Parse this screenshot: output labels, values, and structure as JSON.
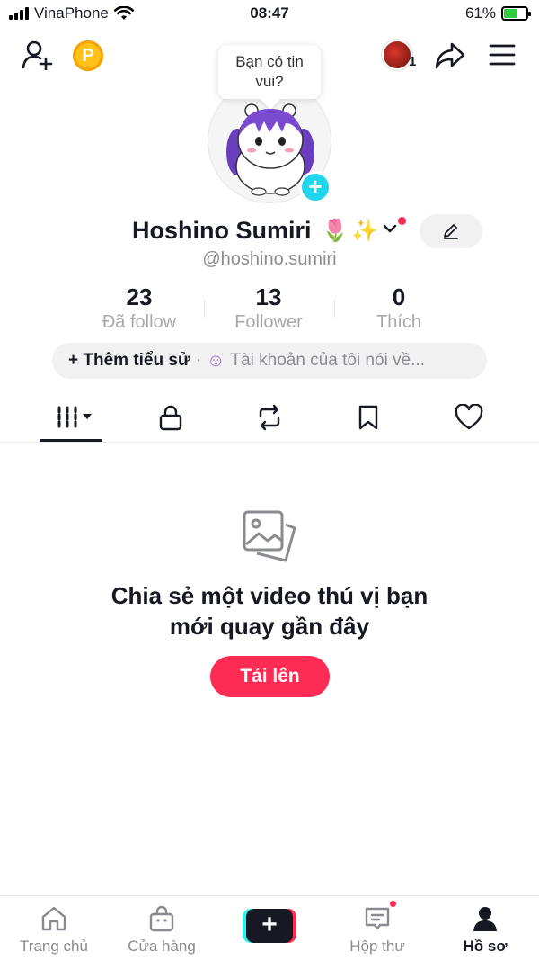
{
  "status_bar": {
    "carrier": "VinaPhone",
    "time": "08:47",
    "battery_percent": "61%",
    "battery_level": 0.61
  },
  "top_bar": {
    "icons": [
      "add-friend-icon",
      "coin-icon",
      "share-icon",
      "menu-icon"
    ],
    "coin_label": "P",
    "story_count": "1"
  },
  "bubble": {
    "text_line1": "Bạn có tin",
    "text_line2": "vui?"
  },
  "profile": {
    "display_name": "Hoshino Sumiri",
    "name_emojis": [
      "🌷",
      "✨"
    ],
    "username": "@hoshino.sumiri"
  },
  "stats": [
    {
      "value": "23",
      "label": "Đã follow"
    },
    {
      "value": "13",
      "label": "Follower"
    },
    {
      "value": "0",
      "label": "Thích"
    }
  ],
  "bio": {
    "add_label": "+ Thêm tiểu sử",
    "separator": "·",
    "hint": "Tài khoản của tôi nói về..."
  },
  "tabs": [
    {
      "icon": "videos-grid-icon",
      "active": true
    },
    {
      "icon": "lock-icon",
      "active": false
    },
    {
      "icon": "repost-icon",
      "active": false
    },
    {
      "icon": "bookmark-icon",
      "active": false
    },
    {
      "icon": "heart-icon",
      "active": false
    }
  ],
  "empty_state": {
    "title_line1": "Chia sẻ một video thú vị bạn",
    "title_line2": "mới quay gần đây",
    "button": "Tải lên"
  },
  "bottom_nav": [
    {
      "label": "Trang chủ",
      "icon": "home-icon"
    },
    {
      "label": "Cửa hàng",
      "icon": "shop-icon"
    },
    {
      "label": "",
      "icon": "create-icon"
    },
    {
      "label": "Hộp thư",
      "icon": "inbox-icon"
    },
    {
      "label": "Hồ sơ",
      "icon": "profile-icon",
      "active": true
    }
  ],
  "colors": {
    "accent": "#fe2c55",
    "cyan": "#25f4ee",
    "text": "#161823",
    "muted": "#8a8b91"
  }
}
